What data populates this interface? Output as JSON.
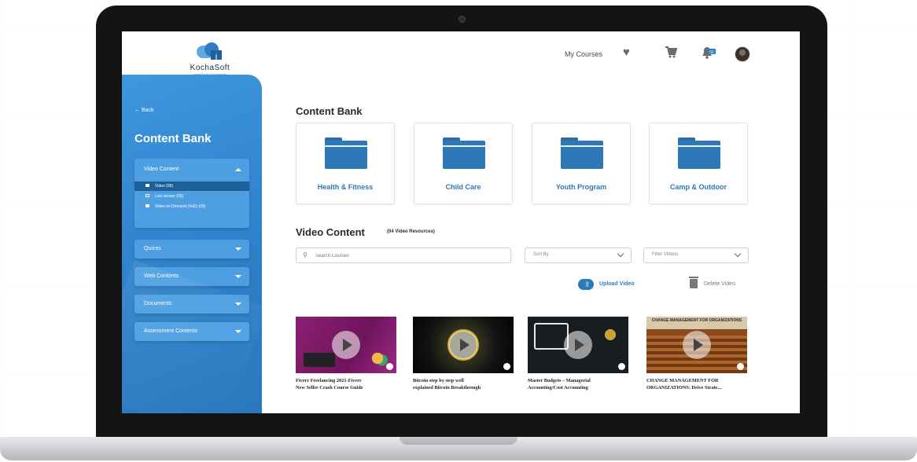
{
  "header": {
    "logo_text": "KochaSoft",
    "logo_tagline": "smart tools to transform",
    "my_courses": "My Courses",
    "notification_count": "02"
  },
  "sidebar": {
    "back": "← Back",
    "title": "Content Bank",
    "video_content": {
      "label": "Video Content",
      "items": [
        {
          "label": "Video (08)",
          "icon": "video-camera-icon"
        },
        {
          "label": "Live stream (03)",
          "icon": "monitor-icon"
        },
        {
          "label": "Video on Demand (VoD) (05)",
          "icon": "film-icon"
        }
      ]
    },
    "sections": [
      {
        "label": "Quizes"
      },
      {
        "label": "Web Contents"
      },
      {
        "label": "Documents"
      },
      {
        "label": "Assessment Contents"
      }
    ]
  },
  "main": {
    "content_bank_title": "Content Bank",
    "folders": [
      {
        "label": "Health & Fitness"
      },
      {
        "label": "Child Care"
      },
      {
        "label": "Youth Program"
      },
      {
        "label": "Camp & Outdoor"
      }
    ],
    "video_title": "Video Content",
    "video_count": "(04 Video Resources)",
    "search_placeholder": "Search Courses",
    "sort_by": "Sort By",
    "filter": "Filter Videos",
    "upload_label": "Upload Video",
    "delete_label": "Delete Video",
    "videos": [
      {
        "title_line1": "Fiverr Freelancing 2021-Fiverr",
        "title_line2": "New Seller Crash Course Guide"
      },
      {
        "title_line1": "Bitcoin step by step well",
        "title_line2": "explained Bitcoin Breakthrough"
      },
      {
        "title_line1": "Master Budgets – Managerial",
        "title_line2": "Accounting/Cost Accounting"
      },
      {
        "title_line1": "CHANGE MANAGEMENT FOR",
        "title_line2": "ORGANIZATIONS: Drive Strate...",
        "thumb_caption": "CHANGE MANAGEMENT FOR ORGANIZATIONS"
      }
    ]
  },
  "colors": {
    "accent": "#2f78b8",
    "sidebar": "#3189d3",
    "sidebar_active": "#1f5f98"
  }
}
